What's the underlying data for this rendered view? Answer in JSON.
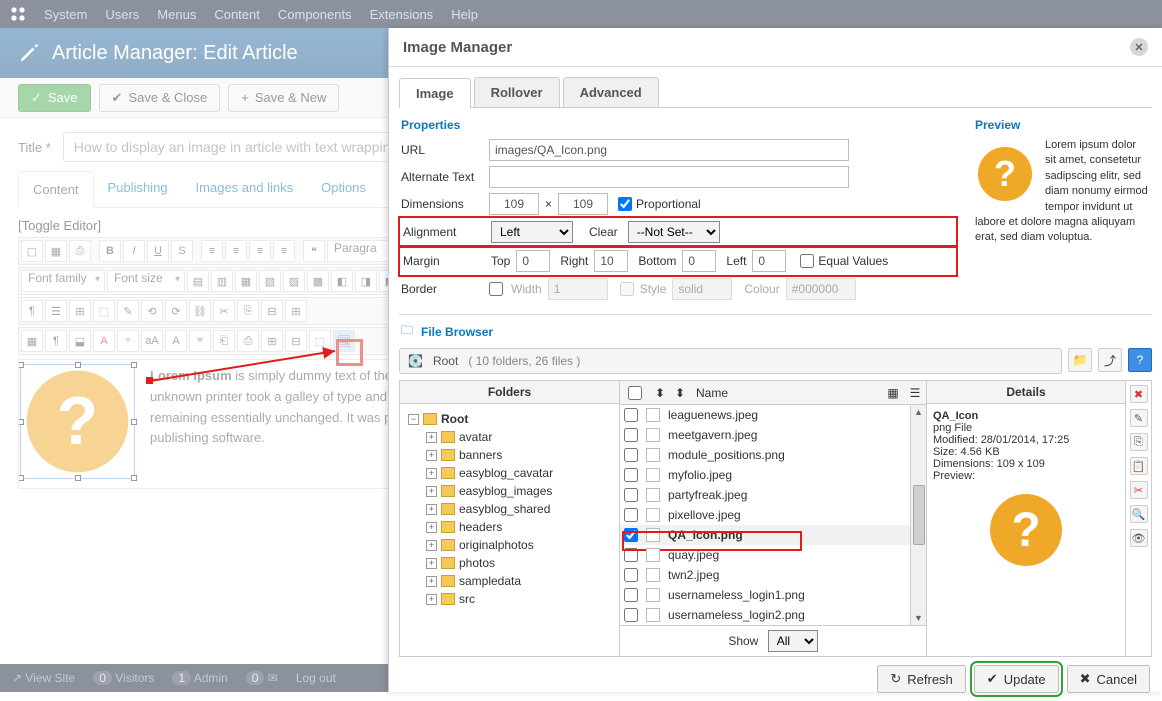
{
  "topnav": [
    "System",
    "Users",
    "Menus",
    "Content",
    "Components",
    "Extensions",
    "Help"
  ],
  "header_title": "Article Manager: Edit Article",
  "actions": {
    "save": "Save",
    "save_close": "Save & Close",
    "save_new": "Save & New"
  },
  "title_label": "Title *",
  "title_value": "How to display an image in article with text wrapping",
  "content_tabs": [
    "Content",
    "Publishing",
    "Images and links",
    "Options"
  ],
  "toggle_editor": "[Toggle Editor]",
  "editor": {
    "paragraph": "Paragra",
    "font_family": "Font family",
    "font_size": "Font size"
  },
  "canvas_text_lead": "Lorem Ipsum",
  "canvas_text": " is simply dummy text of the printing and typesetting industry. Lorem Ipsum has been the industry's standard dummy text ever since the 1500s, when an unknown printer took a galley of type and scrambled it to make a type specimen book. It has survived not only five centuries, but also the leap into electronic typesetting, remaining essentially unchanged. It was popularised in the 1960s with the release of Letraset sheets containing Lorem Ipsum passages, and more recently with desktop publishing software.",
  "footer": {
    "view_site": "View Site",
    "visitors": "Visitors",
    "admin": "Admin",
    "logout": "Log out",
    "v": "0",
    "a": "1",
    "m": "0"
  },
  "modal": {
    "title": "Image Manager",
    "tabs": [
      "Image",
      "Rollover",
      "Advanced"
    ],
    "section_props": "Properties",
    "section_preview": "Preview",
    "url_label": "URL",
    "url_value": "images/QA_Icon.png",
    "alt_label": "Alternate Text",
    "alt_value": "",
    "dim_label": "Dimensions",
    "dim_w": "109",
    "dim_h": "109",
    "dim_x": "×",
    "proportional": "Proportional",
    "align_label": "Alignment",
    "align_value": "Left",
    "clear_label": "Clear",
    "clear_value": "--Not Set--",
    "margin_label": "Margin",
    "top": "Top",
    "right": "Right",
    "bottom": "Bottom",
    "left": "Left",
    "equal": "Equal Values",
    "m_top": "0",
    "m_right": "10",
    "m_bottom": "0",
    "m_left": "0",
    "border_label": "Border",
    "width": "Width",
    "width_v": "1",
    "style": "Style",
    "style_v": "solid",
    "colour": "Colour",
    "colour_v": "#000000",
    "lorem": "Lorem ipsum dolor sit amet, consetetur sadipscing elitr, sed diam nonumy eirmod tempor invidunt ut labore et dolore magna aliquyam erat, sed diam voluptua.",
    "fb_title": "File Browser",
    "crumb_root": "Root",
    "crumb_info": "( 10 folders, 26 files )",
    "col_folders": "Folders",
    "col_name": "Name",
    "col_details": "Details",
    "folders": [
      "avatar",
      "banners",
      "easyblog_cavatar",
      "easyblog_images",
      "easyblog_shared",
      "headers",
      "originalphotos",
      "photos",
      "sampledata",
      "src"
    ],
    "files": [
      "leaguenews.jpeg",
      "meetgavern.jpeg",
      "module_positions.png",
      "myfolio.jpeg",
      "partyfreak.jpeg",
      "pixellove.jpeg",
      "QA_Icon.png",
      "quay.jpeg",
      "twn2.jpeg",
      "usernameless_login1.png",
      "usernameless_login2.png"
    ],
    "selected_file": "QA_Icon.png",
    "details": {
      "name": "QA_Icon",
      "type": "png File",
      "modified": "Modified: 28/01/2014, 17:25",
      "size": "Size: 4.56 KB",
      "dims": "Dimensions: 109 x 109",
      "preview": "Preview:"
    },
    "show": "Show",
    "show_val": "All",
    "refresh": "Refresh",
    "update": "Update",
    "cancel": "Cancel"
  }
}
